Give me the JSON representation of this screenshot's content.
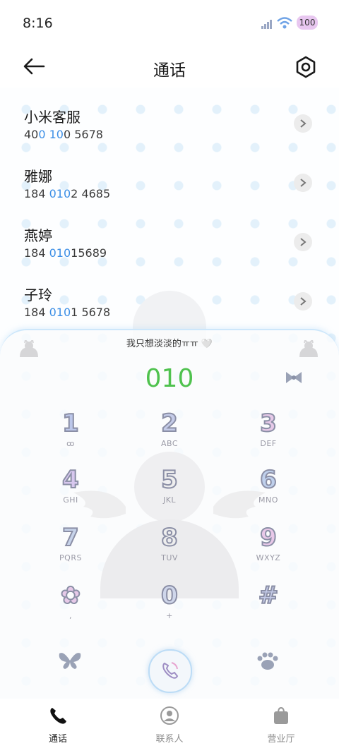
{
  "status_bar": {
    "time": "8:16",
    "battery": "100"
  },
  "header": {
    "title": "通话"
  },
  "contacts": [
    {
      "name": "小米客服",
      "num_pre": "40",
      "num_hl": "0 10",
      "num_post": "0 5678"
    },
    {
      "name": "雅娜",
      "num_pre": "184 ",
      "num_hl": "010",
      "num_post": "2 4685"
    },
    {
      "name": "燕婷",
      "num_pre": "184 ",
      "num_hl": "010",
      "num_post": "15689"
    },
    {
      "name": "子玲",
      "num_pre": "184 ",
      "num_hl": "010",
      "num_post": "1 5678"
    }
  ],
  "dialer": {
    "status_text": "我只想淡淡的ㅠㅠ 🤍",
    "dialed": "010",
    "keys": [
      {
        "digit": "1",
        "sub": "ꝏ",
        "color": "#bcc7ea"
      },
      {
        "digit": "2",
        "sub": "ABC",
        "color": "#c4cbe8"
      },
      {
        "digit": "3",
        "sub": "DEF",
        "color": "#e6c9e8"
      },
      {
        "digit": "4",
        "sub": "GHI",
        "color": "#d7c7ee"
      },
      {
        "digit": "5",
        "sub": "JKL",
        "color": "#eeeeee"
      },
      {
        "digit": "6",
        "sub": "MNO",
        "color": "#bfd0ec"
      },
      {
        "digit": "7",
        "sub": "PQRS",
        "color": "#c7d3ea"
      },
      {
        "digit": "8",
        "sub": "TUV",
        "color": "#eeeeee"
      },
      {
        "digit": "9",
        "sub": "WXYZ",
        "color": "#e8c8e8"
      },
      {
        "digit": "✿",
        "sub": ",",
        "color": "#e6c9e8"
      },
      {
        "digit": "0",
        "sub": "+",
        "color": "#cfd6ea"
      },
      {
        "digit": "#",
        "sub": "",
        "color": "#c4cbe8"
      }
    ]
  },
  "bottom_nav": {
    "calls": "通话",
    "contacts": "联系人",
    "store": "营业厅"
  },
  "colors": {
    "accent_green": "#4fc24e",
    "highlight_blue": "#3d8fe6"
  },
  "icons": {
    "back": "arrow-left-icon",
    "settings": "gear-icon",
    "chevron": "chevron-right-icon",
    "call": "phone-icon",
    "butterfly": "butterfly-icon",
    "paw": "paw-icon",
    "bow": "bow-icon"
  }
}
